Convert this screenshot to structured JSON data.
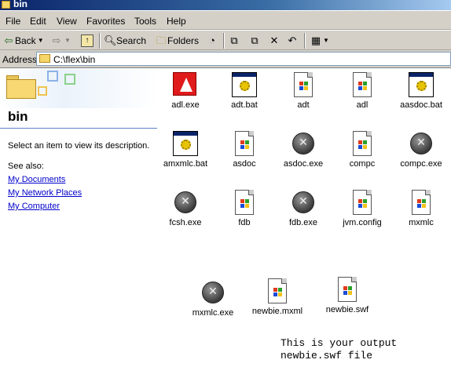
{
  "window": {
    "title": "bin"
  },
  "menu": [
    "File",
    "Edit",
    "View",
    "Favorites",
    "Tools",
    "Help"
  ],
  "toolbar": {
    "back_label": "Back",
    "search_label": "Search",
    "folders_label": "Folders"
  },
  "address": {
    "label": "Address",
    "value": "C:\\flex\\bin"
  },
  "left_pane": {
    "title": "bin",
    "description": "Select an item to view its description.",
    "see_also": "See also:",
    "links": [
      "My Documents",
      "My Network Places",
      "My Computer"
    ]
  },
  "files": [
    {
      "name": "adl.exe",
      "icon": "adobe-app-icon"
    },
    {
      "name": "adt.bat",
      "icon": "batch-file-icon"
    },
    {
      "name": "adt",
      "icon": "windows-document-icon"
    },
    {
      "name": "adl",
      "icon": "windows-document-icon"
    },
    {
      "name": "aasdoc.bat",
      "icon": "batch-file-icon"
    },
    {
      "name": "amxmlc.bat",
      "icon": "batch-file-icon"
    },
    {
      "name": "asdoc",
      "icon": "windows-document-icon"
    },
    {
      "name": "asdoc.exe",
      "icon": "executable-icon"
    },
    {
      "name": "compc",
      "icon": "windows-document-icon"
    },
    {
      "name": "compc.exe",
      "icon": "executable-icon"
    },
    {
      "name": "fcsh.exe",
      "icon": "executable-icon"
    },
    {
      "name": "fdb",
      "icon": "windows-document-icon"
    },
    {
      "name": "fdb.exe",
      "icon": "executable-icon"
    },
    {
      "name": "jvm.config",
      "icon": "windows-document-icon"
    },
    {
      "name": "mxmlc",
      "icon": "windows-document-icon"
    },
    {
      "name": "mxmlc.exe",
      "icon": "executable-icon"
    },
    {
      "name": "newbie.mxml",
      "icon": "windows-document-icon"
    },
    {
      "name": "newbie.swf",
      "icon": "windows-document-icon"
    }
  ],
  "annotation": "This is your output\nnewbie.swf file"
}
